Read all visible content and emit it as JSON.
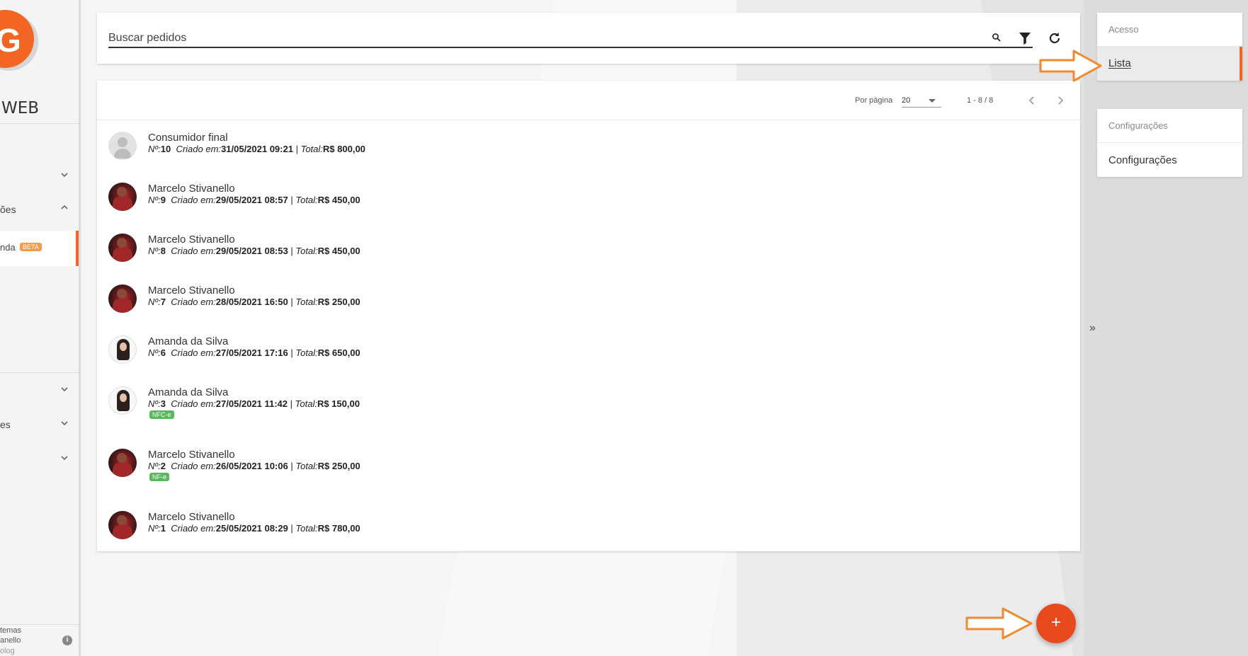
{
  "sidebar": {
    "logo_letter": "G",
    "logo_text": "WEB",
    "items": [
      {
        "label": "ões"
      },
      {
        "label": "nda",
        "badge": "BETA"
      },
      {
        "label": "es"
      }
    ],
    "footer_lines": [
      "temas",
      "anello",
      "olog"
    ],
    "info_icon": "i",
    "accent": "#f26522"
  },
  "search": {
    "placeholder": "Buscar pedidos",
    "value": ""
  },
  "pagination": {
    "per_page_label": "Por página",
    "per_page_value": "20",
    "range": "1 - 8 / 8"
  },
  "orders": [
    {
      "customer": "Consumidor final",
      "number_label": "Nº:",
      "number": "10",
      "created_label": "Criado em:",
      "created": "31/05/2021 09:21",
      "total_label": "Total:",
      "total": "R$ 800,00",
      "badge": "",
      "avatar": "placeholder"
    },
    {
      "customer": "Marcelo Stivanello",
      "number_label": "Nº:",
      "number": "9",
      "created_label": "Criado em:",
      "created": "29/05/2021 08:57",
      "total_label": "Total:",
      "total": "R$ 450,00",
      "badge": "",
      "avatar": "marcelo"
    },
    {
      "customer": "Marcelo Stivanello",
      "number_label": "Nº:",
      "number": "8",
      "created_label": "Criado em:",
      "created": "29/05/2021 08:53",
      "total_label": "Total:",
      "total": "R$ 450,00",
      "badge": "",
      "avatar": "marcelo"
    },
    {
      "customer": "Marcelo Stivanello",
      "number_label": "Nº:",
      "number": "7",
      "created_label": "Criado em:",
      "created": "28/05/2021 16:50",
      "total_label": "Total:",
      "total": "R$ 250,00",
      "badge": "",
      "avatar": "marcelo"
    },
    {
      "customer": "Amanda da Silva",
      "number_label": "Nº:",
      "number": "6",
      "created_label": "Criado em:",
      "created": "27/05/2021 17:16",
      "total_label": "Total:",
      "total": "R$ 650,00",
      "badge": "",
      "avatar": "amanda"
    },
    {
      "customer": "Amanda da Silva",
      "number_label": "Nº:",
      "number": "3",
      "created_label": "Criado em:",
      "created": "27/05/2021 11:42",
      "total_label": "Total:",
      "total": "R$ 150,00",
      "badge": "NFC-e",
      "avatar": "amanda"
    },
    {
      "customer": "Marcelo Stivanello",
      "number_label": "Nº:",
      "number": "2",
      "created_label": "Criado em:",
      "created": "26/05/2021 10:06",
      "total_label": "Total:",
      "total": "R$ 250,00",
      "badge": "NF-e",
      "avatar": "marcelo"
    },
    {
      "customer": "Marcelo Stivanello",
      "number_label": "Nº:",
      "number": "1",
      "created_label": "Criado em:",
      "created": "25/05/2021 08:29",
      "total_label": "Total:",
      "total": "R$ 780,00",
      "badge": "",
      "avatar": "marcelo"
    }
  ],
  "right_panel": {
    "sections": [
      {
        "title": "Acesso",
        "items": [
          {
            "label": "Lista",
            "active": true
          }
        ]
      },
      {
        "title": "Configurações",
        "items": [
          {
            "label": "Configurações",
            "active": false
          }
        ]
      }
    ],
    "collapse_glyph": "»"
  },
  "fab": {
    "label": "+",
    "color": "#e8491d"
  },
  "icons": {
    "search": "search-icon",
    "filter": "filter-icon",
    "refresh": "refresh-icon",
    "prev": "chevron-left-icon",
    "next": "chevron-right-icon",
    "annotation_arrow": "arrow-right-icon"
  }
}
